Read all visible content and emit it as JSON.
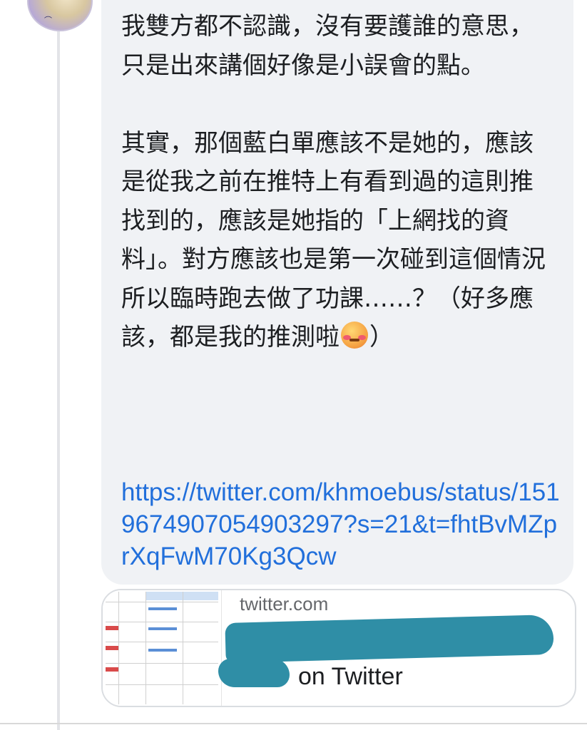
{
  "comment": {
    "paragraph1": "我雙方都不認識，沒有要護誰的意思，只是出來講個好像是小誤會的點。",
    "paragraph2_text": "其實，那個藍白單應該不是她的，應該是從我之前在推特上有看到過的這則推找到的，應該是她指的「上網找的資料」。對方應該也是第一次碰到這個情況所以臨時跑去做了功課……？（好多應該，都是我的推測啦",
    "paragraph2_end": "）",
    "emoji_icon": "woozy-face-emoji"
  },
  "link": {
    "url": "https://twitter.com/khmoebus/status/1519674907054903297?s=21&t=fhtBvMZprXqFwM70Kg3Qcw"
  },
  "preview": {
    "domain": "twitter.com",
    "title_suffix": "on Twitter",
    "redaction_color": "#2f8ea6"
  },
  "colors": {
    "bubble": "#f0f2f5",
    "link": "#216fdb",
    "text": "#1c1e21",
    "muted": "#65676b"
  }
}
